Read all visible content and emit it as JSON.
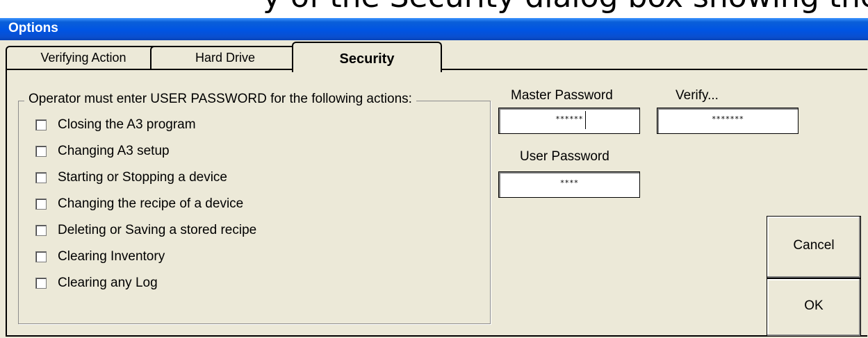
{
  "caption": "y of the Security dialog box showing the",
  "window": {
    "title": "Options"
  },
  "tabs": [
    {
      "label": "Verifying Action"
    },
    {
      "label": "Hard Drive"
    },
    {
      "label": "Security",
      "active": true
    }
  ],
  "security": {
    "group_title": "Operator must enter USER PASSWORD for the following actions:",
    "actions": [
      {
        "label": "Closing the A3 program",
        "checked": false
      },
      {
        "label": "Changing A3 setup",
        "checked": false
      },
      {
        "label": "Starting or Stopping a device",
        "checked": false
      },
      {
        "label": "Changing the recipe of a device",
        "checked": false
      },
      {
        "label": "Deleting or Saving a stored recipe",
        "checked": false
      },
      {
        "label": "Clearing Inventory",
        "checked": false
      },
      {
        "label": "Clearing any Log",
        "checked": false
      }
    ],
    "master_password": {
      "label": "Master Password",
      "value": "******"
    },
    "verify": {
      "label": "Verify...",
      "value": "*******"
    },
    "user_password": {
      "label": "User Password",
      "value": "****"
    }
  },
  "buttons": {
    "cancel": "Cancel",
    "ok": "OK"
  }
}
